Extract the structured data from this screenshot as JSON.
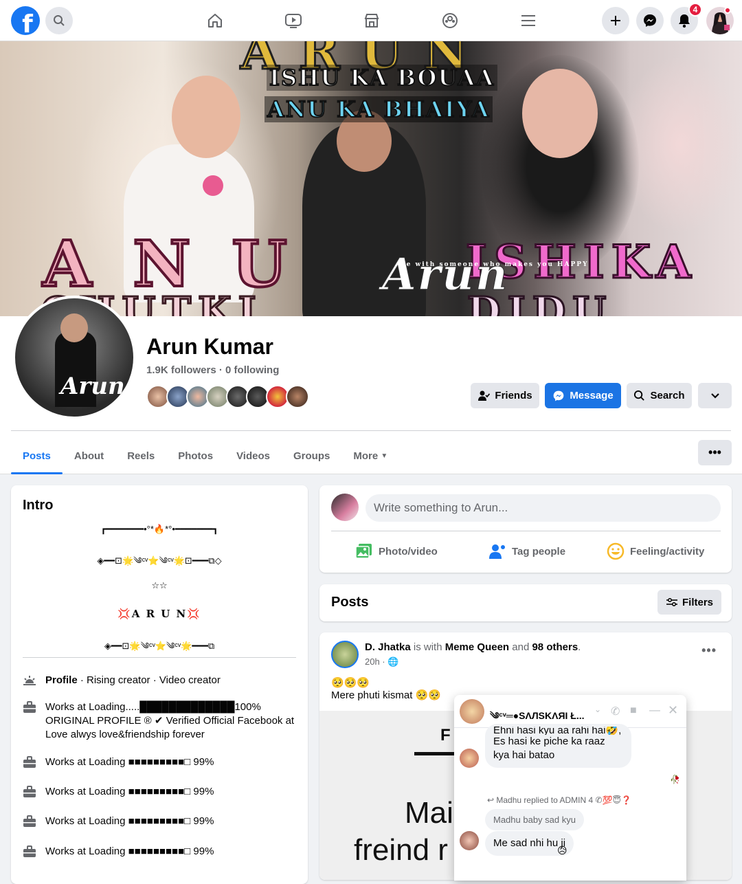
{
  "topbar": {
    "logo": "f",
    "notifications_count": "4",
    "icons": [
      "search-icon",
      "home-icon",
      "watch-icon",
      "marketplace-icon",
      "groups-icon",
      "menu-icon",
      "create-icon",
      "messenger-icon",
      "notifications-icon"
    ]
  },
  "cover": {
    "line1": "A R U N",
    "line2": "ISHU KA BOUAA",
    "line3": "ANU KA BHAIYA",
    "left_big": "A N U",
    "left_sub": "CHUTKI",
    "right_big": "ISHIKA",
    "right_sub": "DIDU",
    "signature": "Arun",
    "tagline": "Be with someone who makes you HAPPY"
  },
  "profile": {
    "name": "Arun Kumar",
    "followers": "1.9K followers · 0 following",
    "friends_label": "Friends",
    "message_label": "Message",
    "search_label": "Search"
  },
  "tabs": [
    "Posts",
    "About",
    "Reels",
    "Photos",
    "Videos",
    "Groups",
    "More"
  ],
  "intro": {
    "title": "Intro",
    "bio_lines": [
      "┏━━━━━━━•°*🔥*°•━━━━━━━┓",
      "◈━━⊡🌟༄ᶜᵛ⭐༄ᶜᵛ🌟⊡━━━⧉◇",
      "☆☆",
      "💢A R U N💢",
      "◈━━⊡🌟༄ᶜᵛ⭐༄ᶜᵛ🌟━━━⧉"
    ],
    "profile_label": "Profile",
    "profile_detail": " · Rising creator · Video creator",
    "work1": "Works at Loading.....█████████████100% ORIGINAL PROFILE ® ✔ Verified Official Facebook at Love alwys love&friendship forever",
    "work_repeat": "Works at Loading ■■■■■■■■■□ 99%"
  },
  "composer": {
    "placeholder": "Write something to Arun...",
    "photo_label": "Photo/video",
    "tag_label": "Tag people",
    "feeling_label": "Feeling/activity"
  },
  "posts_header": {
    "title": "Posts",
    "filters_label": "Filters"
  },
  "post": {
    "author": "D. Jhatka",
    "with_text": " is with ",
    "tagged": "Meme Queen",
    "and_text": " and ",
    "others": "98 others",
    "time": "20h · ",
    "emojis": "🥺🥺🥺",
    "text": "Mere phuti kismat 🥺🥺",
    "image_letter": "F",
    "image_line1": "Mai",
    "image_line2": "freind r"
  },
  "chat": {
    "title": "༄ᶜᵛ═●SΛЛSKΛЯI Ł...",
    "msg1_top": "Ehni hasi kyu aa rahi hai🤣,",
    "msg1": "Es hasi ke piche ka raaz kya hai batao",
    "replied_label": "↩ Madhu replied to ADMIN 4 ✆💯😇❓",
    "quote": "Madhu baby sad kyu",
    "msg2": "Me sad nhi hu ji",
    "reaction": "😥"
  },
  "colors": {
    "brand": "#1877f2",
    "message_btn": "#1b74e4",
    "badge": "#e41e3f"
  }
}
